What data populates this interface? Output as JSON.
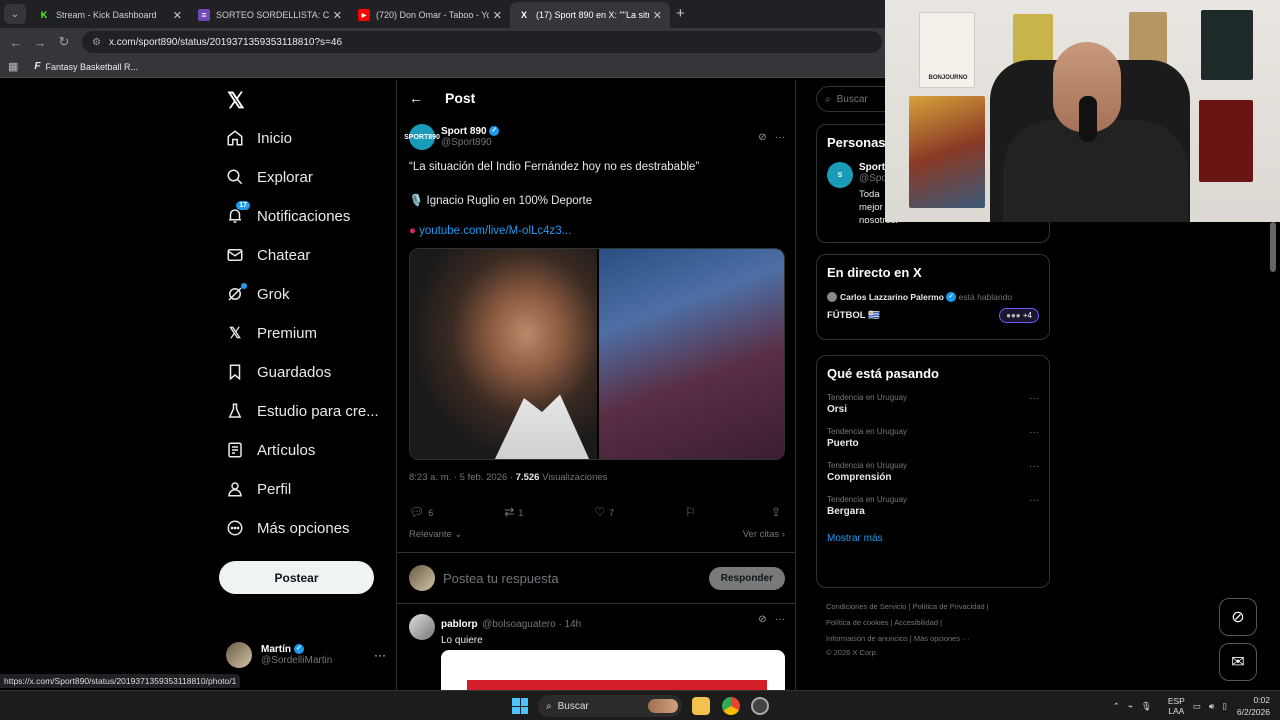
{
  "browser": {
    "tabs": [
      {
        "title": "Stream - Kick Dashboard",
        "fav": "K",
        "fav_color": "#53fc18"
      },
      {
        "title": "SORTEO SORDELLISTA: CAMISETA",
        "fav": "≡",
        "fav_color": "#7248b9"
      },
      {
        "title": "(720) Don Omar - Taboo - YouTube",
        "fav": "▶",
        "fav_color": "#ff0000"
      },
      {
        "title": "(17) Sport 890 en X: \"\"La situació",
        "fav": "X",
        "fav_color": "#000000"
      }
    ],
    "url": "x.com/sport890/status/2019371359353118810?s=46",
    "bookmark": "Fantasy Basketball R..."
  },
  "nav": {
    "items": [
      {
        "label": "Inicio",
        "icon": "home-icon"
      },
      {
        "label": "Explorar",
        "icon": "search-icon"
      },
      {
        "label": "Notificaciones",
        "icon": "bell-icon",
        "badge": "17"
      },
      {
        "label": "Chatear",
        "icon": "mail-icon"
      },
      {
        "label": "Grok",
        "icon": "grok-icon"
      },
      {
        "label": "Premium",
        "icon": "x-icon"
      },
      {
        "label": "Guardados",
        "icon": "bookmark-icon"
      },
      {
        "label": "Estudio para cre...",
        "icon": "flask-icon"
      },
      {
        "label": "Artículos",
        "icon": "document-icon"
      },
      {
        "label": "Perfil",
        "icon": "person-icon"
      },
      {
        "label": "Más opciones",
        "icon": "more-icon"
      }
    ],
    "post_button": "Postear",
    "account": {
      "name": "Martín",
      "handle": "@SordelliMartin"
    }
  },
  "post": {
    "header": "Post",
    "author_name": "Sport 890",
    "author_handle": "@Sport890",
    "avatar_text": "SPORT890",
    "line1": "“La situación del Indio Fernández hoy no es destrabable”",
    "line2": "🎙️ Ignacio Ruglio en 100% Deporte",
    "link": "youtube.com/live/M-olLc4z3...",
    "meta_time": "8:23 a. m. · 5 feb. 2026 · ",
    "views": "7.526",
    "views_label": " Visualizaciones",
    "replies": "6",
    "reposts": "1",
    "likes": "7",
    "sort_label": "Relevante",
    "quotes_label": "Ver citas",
    "reply_placeholder": "Postea tu respuesta",
    "reply_button": "Responder"
  },
  "comment": {
    "name": "pablorp",
    "handle": "@bolsoaguatero · 14h",
    "text": "Lo quiere"
  },
  "right": {
    "search_placeholder": "Buscar",
    "personas_title": "Personas",
    "personas_name": "Sport",
    "personas_handle": "@Spo",
    "personas_bio1": "Toda",
    "personas_bio2": "mejor",
    "personas_bio3": "nosotros.",
    "live_title": "En directo en X",
    "live_host": "Carlos Lazzarino Palermo",
    "live_status": "está hablando",
    "live_topic": "FÚTBOL 🇺🇾",
    "live_more": "+4",
    "trends_title": "Qué está pasando",
    "trends": [
      {
        "context": "Tendencia en Uruguay",
        "name": "Orsi"
      },
      {
        "context": "Tendencia en Uruguay",
        "name": "Puerto"
      },
      {
        "context": "Tendencia en Uruguay",
        "name": "Comprensión"
      },
      {
        "context": "Tendencia en Uruguay",
        "name": "Bergara"
      }
    ],
    "show_more": "Mostrar más",
    "footer1": "Condiciones de Servicio  |  Política de Privacidad  |",
    "footer2": "Política de cookies  |  Accesibilidad  |",
    "footer3": "Información de anuncios  |  Más opciones ···",
    "footer4": "© 2026 X Corp."
  },
  "status_url": "https://x.com/Sport890/status/2019371359353118810/photo/1",
  "taskbar": {
    "search": "Buscar",
    "lang1": "ESP",
    "lang2": "LAA",
    "time": "0:02",
    "date": "6/2/2026"
  },
  "webcam_poster_text": "BONJOURNO",
  "colors": {
    "accent": "#1d9bf0",
    "bg": "#000000"
  }
}
